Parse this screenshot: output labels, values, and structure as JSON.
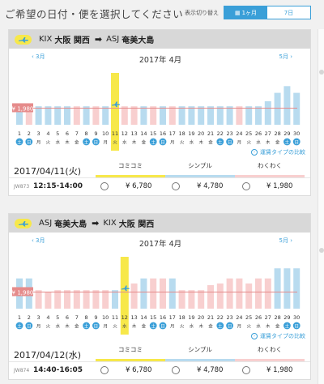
{
  "page_title": "ご希望の日付・便を選択してください",
  "view_toggle": {
    "label": "表示切り替え",
    "options": [
      {
        "label": "1ヶ月",
        "active": true
      },
      {
        "label": "7日",
        "active": false
      }
    ]
  },
  "colors": {
    "blue": "#3a9fd8",
    "bar_blue": "#b8dbef",
    "bar_pink": "#f8cfcf",
    "highlight": "#f7e84a",
    "ref_red": "#e58b8b"
  },
  "weekdays": [
    "土",
    "日",
    "月",
    "火",
    "水",
    "木",
    "金",
    "土",
    "日",
    "月",
    "火",
    "水",
    "木",
    "金",
    "土",
    "日",
    "月",
    "火",
    "水",
    "木",
    "金",
    "土",
    "日",
    "月",
    "火",
    "水",
    "木",
    "金",
    "土",
    "日"
  ],
  "holidays": [
    1,
    2,
    8,
    9,
    15,
    16,
    22,
    23,
    29,
    30
  ],
  "cards": [
    {
      "route": {
        "from_code": "KIX",
        "from_city": "大阪 関西",
        "to_code": "ASJ",
        "to_city": "奄美大島"
      },
      "calendar": {
        "month_label": "2017年 4月",
        "prev_label": "3月",
        "next_label": "5月",
        "selected_day": 11,
        "days": [
          1,
          2,
          3,
          4,
          5,
          6,
          7,
          8,
          9,
          10,
          11,
          12,
          13,
          14,
          15,
          16,
          17,
          18,
          19,
          20,
          21,
          22,
          23,
          24,
          25,
          26,
          27,
          28,
          29,
          30
        ]
      },
      "chart_data": {
        "type": "bar",
        "title": "2017年 4月",
        "x": [
          1,
          2,
          3,
          4,
          5,
          6,
          7,
          8,
          9,
          10,
          11,
          12,
          13,
          14,
          15,
          16,
          17,
          18,
          19,
          20,
          21,
          22,
          23,
          24,
          25,
          26,
          27,
          28,
          29,
          30
        ],
        "values": [
          2200,
          2200,
          2200,
          2200,
          2200,
          2200,
          2200,
          2200,
          2200,
          2200,
          1980,
          2200,
          2200,
          2200,
          2200,
          2200,
          2200,
          2200,
          2200,
          2200,
          2200,
          2200,
          2200,
          2200,
          2200,
          2200,
          2800,
          3800,
          4600,
          3800
        ],
        "colors": [
          "blue",
          "pink",
          "blue",
          "blue",
          "blue",
          "blue",
          "pink",
          "blue",
          "pink",
          "blue",
          "blue",
          "pink",
          "pink",
          "blue",
          "pink",
          "blue",
          "pink",
          "blue",
          "blue",
          "blue",
          "blue",
          "blue",
          "blue",
          "pink",
          "blue",
          "blue",
          "blue",
          "blue",
          "blue",
          "blue"
        ],
        "reference_line": {
          "value": 1980,
          "label": "¥ 1,980"
        },
        "ylim": [
          0,
          5400
        ]
      },
      "compare_label": "運賃タイプの比較",
      "selected_date": "2017/04/11(火)",
      "fare_types": [
        {
          "name": "コミコミ",
          "color": "#f7e84a"
        },
        {
          "name": "シンプル",
          "color": "#b8dbef"
        },
        {
          "name": "わくわく",
          "color": "#f8cfcf"
        }
      ],
      "flights": [
        {
          "number": "JW873",
          "time": "12:15-14:00",
          "prices": [
            "¥ 6,780",
            "¥ 4,780",
            "¥ 1,980"
          ]
        }
      ]
    },
    {
      "route": {
        "from_code": "ASJ",
        "from_city": "奄美大島",
        "to_code": "KIX",
        "to_city": "大阪 関西"
      },
      "calendar": {
        "month_label": "2017年 4月",
        "prev_label": "3月",
        "next_label": "5月",
        "selected_day": 12,
        "days": [
          1,
          2,
          3,
          4,
          5,
          6,
          7,
          8,
          9,
          10,
          11,
          12,
          13,
          14,
          15,
          16,
          17,
          18,
          19,
          20,
          21,
          22,
          23,
          24,
          25,
          26,
          27,
          28,
          29,
          30
        ]
      },
      "chart_data": {
        "type": "bar",
        "title": "2017年 4月",
        "x": [
          1,
          2,
          3,
          4,
          5,
          6,
          7,
          8,
          9,
          10,
          11,
          12,
          13,
          14,
          15,
          16,
          17,
          18,
          19,
          20,
          21,
          22,
          23,
          24,
          25,
          26,
          27,
          28,
          29,
          30
        ],
        "values": [
          3600,
          3600,
          2200,
          1980,
          2200,
          2200,
          2200,
          2200,
          2200,
          2200,
          2200,
          1980,
          3000,
          3600,
          3600,
          3600,
          3600,
          2200,
          2200,
          2200,
          2800,
          3000,
          3600,
          3600,
          3000,
          3600,
          3600,
          4800,
          4800,
          4800
        ],
        "colors": [
          "blue",
          "blue",
          "pink",
          "pink",
          "pink",
          "pink",
          "pink",
          "pink",
          "pink",
          "pink",
          "blue",
          "pink",
          "pink",
          "blue",
          "pink",
          "pink",
          "blue",
          "pink",
          "pink",
          "pink",
          "pink",
          "pink",
          "pink",
          "pink",
          "pink",
          "pink",
          "pink",
          "blue",
          "blue",
          "blue"
        ],
        "reference_line": {
          "value": 1980,
          "label": "¥ 1,980"
        },
        "ylim": [
          0,
          5400
        ]
      },
      "compare_label": "運賃タイプの比較",
      "selected_date": "2017/04/12(水)",
      "fare_types": [
        {
          "name": "コミコミ",
          "color": "#f7e84a"
        },
        {
          "name": "シンプル",
          "color": "#b8dbef"
        },
        {
          "name": "わくわく",
          "color": "#f8cfcf"
        }
      ],
      "flights": [
        {
          "number": "JW874",
          "time": "14:40-16:05",
          "prices": [
            "¥ 6,780",
            "¥ 4,780",
            "¥ 1,980"
          ]
        }
      ]
    }
  ]
}
